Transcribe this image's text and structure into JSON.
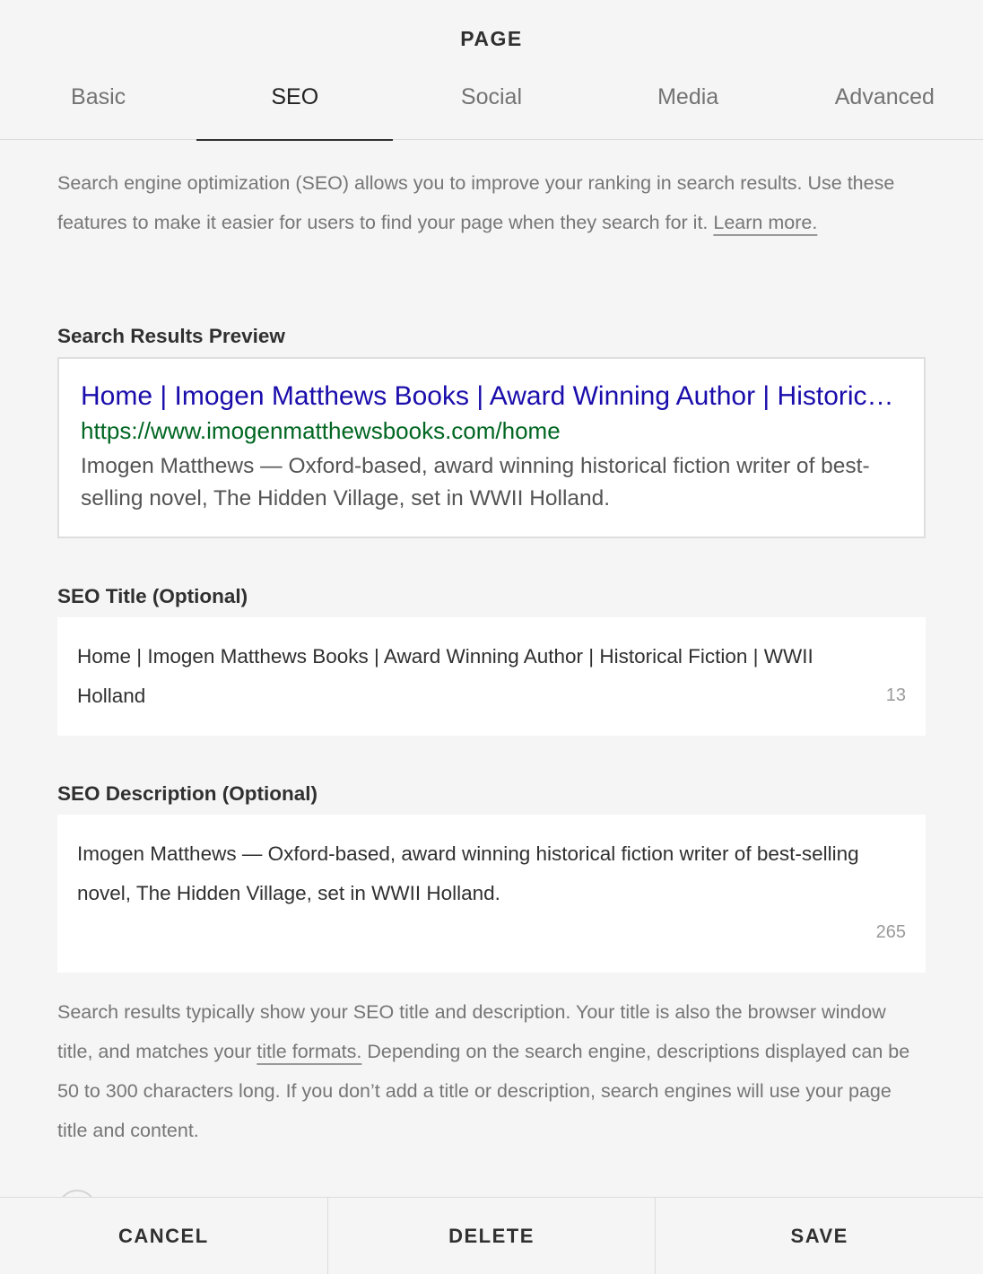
{
  "header": {
    "title": "PAGE",
    "tabs": [
      {
        "label": "Basic"
      },
      {
        "label": "SEO"
      },
      {
        "label": "Social"
      },
      {
        "label": "Media"
      },
      {
        "label": "Advanced"
      }
    ],
    "active_tab": "SEO"
  },
  "intro": {
    "text": "Search engine optimization (SEO) allows you to improve your ranking in search results. Use these features to make it easier for users to find your page when they search for it.",
    "link": "Learn more."
  },
  "preview": {
    "label": "Search Results Preview",
    "title": "Home | Imogen Matthews Books | Award Winning Author | Historical Fiction | WWII Holland",
    "url": "https://www.imogenmatthewsbooks.com/home",
    "description": "Imogen Matthews — Oxford-based, award winning historical fiction writer of best-selling novel, The Hidden Village, set in WWII Holland.",
    "colors": {
      "title": "#1a0dab",
      "url": "#006621"
    }
  },
  "seo_title": {
    "label": "SEO Title (Optional)",
    "value": "Home | Imogen Matthews Books | Award Winning Author | Historical Fiction | WWII Holland",
    "counter": "13"
  },
  "seo_description": {
    "label": "SEO Description (Optional)",
    "value": "Imogen Matthews — Oxford-based, award winning historical fiction writer of best-selling novel, The Hidden Village, set in WWII Holland.",
    "counter": "265"
  },
  "footnote": {
    "text_before": "Search results typically show your SEO title and description. Your title is also the browser window title, and matches your",
    "link": "title formats.",
    "text_after": "Depending on the search engine, descriptions displayed can be 50 to 300 characters long. If you don’t add a title or description, search engines will use your page title and content."
  },
  "footer": {
    "cancel_label": "CANCEL",
    "delete_label": "DELETE",
    "save_label": "SAVE"
  }
}
